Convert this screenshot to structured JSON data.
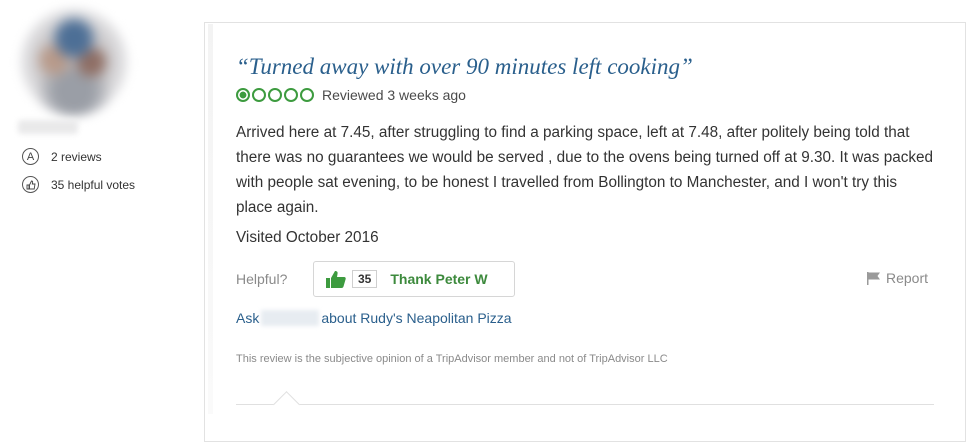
{
  "member": {
    "reviews": "2 reviews",
    "helpful_votes": "35 helpful votes"
  },
  "review": {
    "title": "“Turned away with over 90 minutes left cooking”",
    "rating_bubbles": 1,
    "rating_max": 5,
    "reviewed": "Reviewed 3 weeks ago",
    "body": "Arrived here at 7.45, after struggling to find a parking space, left at 7.48, after politely being told that there was no guarantees we would be served , due to the ovens being turned off at 9.30. It was packed with people sat evening, to be honest I travelled from Bollington to Manchester, and I won't try this place again.",
    "visited": "Visited October 2016"
  },
  "actions": {
    "helpful_label": "Helpful?",
    "thank_count": "35",
    "thank_label": "Thank Peter W",
    "report_label": "Report",
    "ask_prefix": "Ask",
    "ask_suffix": "about Rudy's Neapolitan Pizza"
  },
  "disclaimer": "This review is the subjective opinion of a TripAdvisor member and not of TripAdvisor LLC",
  "colors": {
    "title": "#2a5f8c",
    "rating_green": "#3d9b3f",
    "thank_green": "#3d8a3d"
  },
  "icons": {
    "reviews": "reviews-badge-icon",
    "helpful": "thumbs-up-badge-icon",
    "thank": "thumbs-up-icon",
    "report": "flag-icon"
  }
}
